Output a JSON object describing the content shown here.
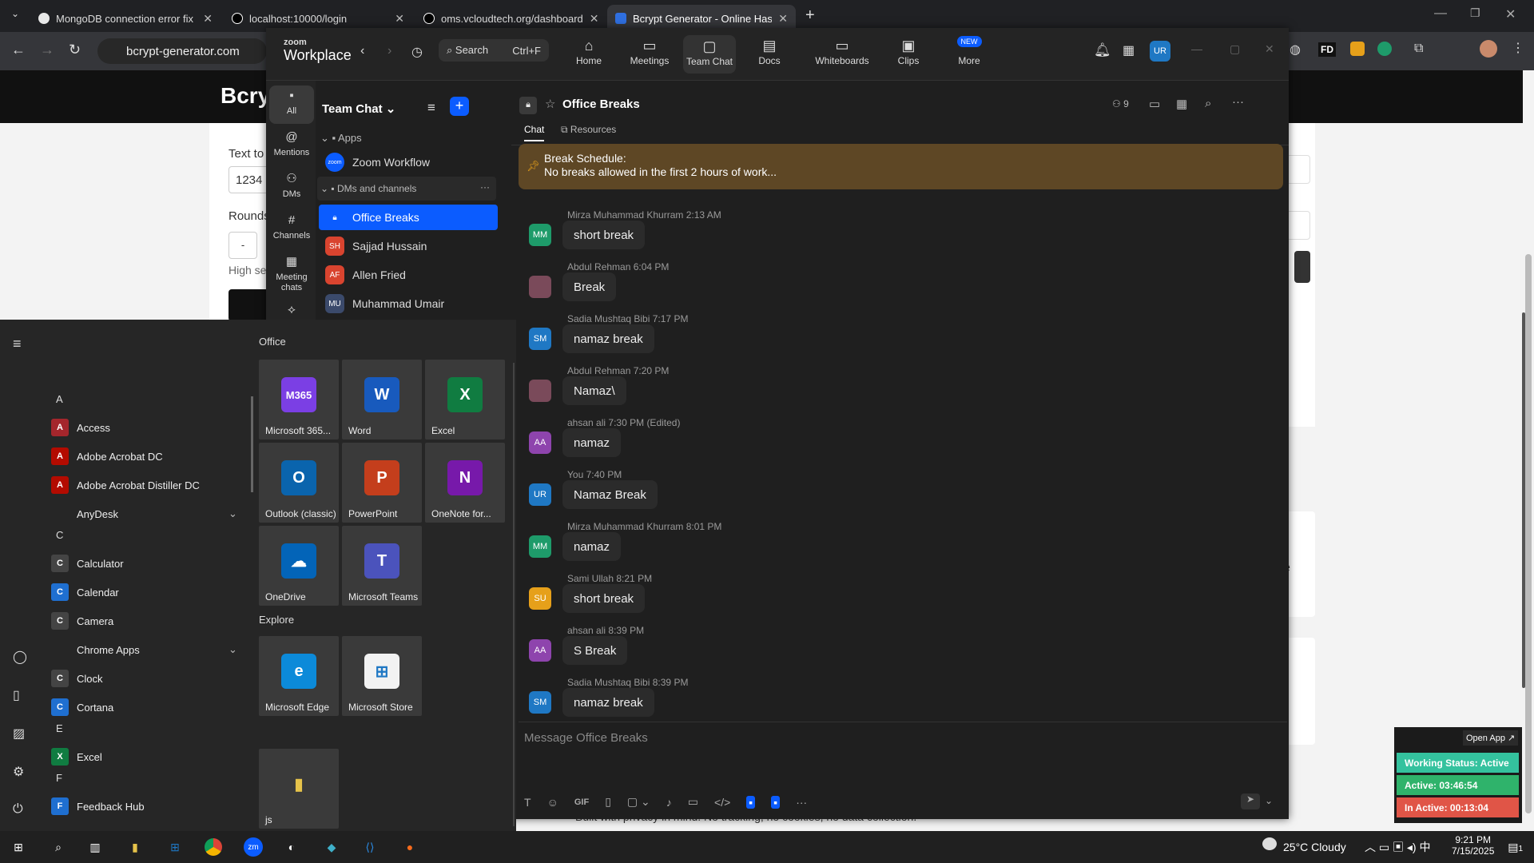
{
  "browser": {
    "tabs": [
      {
        "label": "MongoDB connection error fix",
        "active": false
      },
      {
        "label": "localhost:10000/login",
        "active": false
      },
      {
        "label": "oms.vcloudtech.org/dashboard",
        "active": false
      },
      {
        "label": "Bcrypt Generator - Online Hash",
        "active": true
      }
    ],
    "url": "bcrypt-generator.com"
  },
  "behind_page": {
    "title": "Bcry",
    "text_to_label": "Text to",
    "input_value": "1234",
    "rounds_label": "Rounds",
    "minus": "-",
    "high_label": "High se",
    "footer_text": "Built with privacy in mind. No tracking, no cookies, no data collection.",
    "side_letter": "e"
  },
  "zoom": {
    "brand_top": "zoom",
    "brand": "Workplace",
    "search_label": "Search",
    "search_shortcut": "Ctrl+F",
    "nav": [
      {
        "label": "Home",
        "icon": "home-icon"
      },
      {
        "label": "Meetings",
        "icon": "video-icon"
      },
      {
        "label": "Team Chat",
        "icon": "chat-icon"
      },
      {
        "label": "Docs",
        "icon": "doc-icon"
      },
      {
        "label": "Whiteboards",
        "icon": "whiteboard-icon"
      },
      {
        "label": "Clips",
        "icon": "clips-icon"
      },
      {
        "label": "More",
        "icon": "more-icon",
        "badge": "NEW"
      }
    ],
    "avatar": "UR",
    "rail": [
      "All",
      "Mentions",
      "DMs",
      "Channels",
      "Meeting chats"
    ],
    "list_title": "Team Chat",
    "apps_section": "Apps",
    "app_item": "Zoom Workflow",
    "app_badge": "zoom",
    "dm_section": "DMs and channels",
    "dm_items": [
      {
        "label": "Office Breaks",
        "initials": "",
        "color": "#0b5cff"
      },
      {
        "label": "Sajjad Hussain",
        "initials": "SH",
        "color": "#d9442f"
      },
      {
        "label": "Allen Fried",
        "initials": "AF",
        "color": "#d9442f"
      },
      {
        "label": "Muhammad Umair",
        "initials": "MU",
        "color": "#3b4a6b"
      }
    ],
    "channel_title": "Office Breaks",
    "member_count": "9",
    "tabs": [
      "Chat",
      "Resources"
    ],
    "pinned_title": "Break Schedule:",
    "pinned_text": "No breaks allowed in the first 2 hours of work...",
    "messages": [
      {
        "author": "Mirza Muhammad Khurram",
        "time": "2:13 AM",
        "initials": "MM",
        "color": "#1e9b6a",
        "text": "short break",
        "edited": ""
      },
      {
        "author": "Abdul Rehman",
        "time": "6:04 PM",
        "initials": "",
        "color": "#7a4a5a",
        "text": "Break",
        "edited": ""
      },
      {
        "author": "Sadia Mushtaq Bibi",
        "time": "7:17 PM",
        "initials": "SM",
        "color": "#1f78c4",
        "text": "namaz break",
        "edited": ""
      },
      {
        "author": "Abdul Rehman",
        "time": "7:20 PM",
        "initials": "",
        "color": "#7a4a5a",
        "text": "Namaz\\",
        "edited": ""
      },
      {
        "author": "ahsan ali",
        "time": "7:30 PM",
        "initials": "AA",
        "color": "#8e44ad",
        "text": "namaz",
        "edited": "(Edited)"
      },
      {
        "author": "You",
        "time": "7:40 PM",
        "initials": "UR",
        "color": "#1f78c4",
        "text": "Namaz Break",
        "edited": ""
      },
      {
        "author": "Mirza Muhammad Khurram",
        "time": "8:01 PM",
        "initials": "MM",
        "color": "#1e9b6a",
        "text": "namaz",
        "edited": ""
      },
      {
        "author": "Sami Ullah",
        "time": "8:21 PM",
        "initials": "SU",
        "color": "#e6a01a",
        "text": "short break",
        "edited": ""
      },
      {
        "author": "ahsan ali",
        "time": "8:39 PM",
        "initials": "AA",
        "color": "#8e44ad",
        "text": "S Break",
        "edited": ""
      },
      {
        "author": "Sadia Mushtaq Bibi",
        "time": "8:39 PM",
        "initials": "SM",
        "color": "#1f78c4",
        "text": "namaz break",
        "edited": ""
      }
    ],
    "compose_placeholder": "Message Office Breaks",
    "gif_label": "GIF"
  },
  "start_menu": {
    "office_label": "Office",
    "explore_label": "Explore",
    "letters": [
      "A",
      "C",
      "E",
      "F"
    ],
    "apps": [
      {
        "label": "Access",
        "icon": "A",
        "color": "#a4262c"
      },
      {
        "label": "Adobe Acrobat DC",
        "icon": "A",
        "color": "#b30b00"
      },
      {
        "label": "Adobe Acrobat Distiller DC",
        "icon": "A",
        "color": "#b30b00"
      },
      {
        "label": "AnyDesk",
        "icon": "",
        "color": ""
      },
      {
        "label": "Calculator",
        "icon": "C",
        "color": "#444"
      },
      {
        "label": "Calendar",
        "icon": "C",
        "color": "#1f6fd0"
      },
      {
        "label": "Camera",
        "icon": "C",
        "color": "#444"
      },
      {
        "label": "Chrome Apps",
        "icon": "",
        "color": ""
      },
      {
        "label": "Clock",
        "icon": "C",
        "color": "#444"
      },
      {
        "label": "Cortana",
        "icon": "C",
        "color": "#1f6fd0"
      },
      {
        "label": "Excel",
        "icon": "X",
        "color": "#107c41"
      },
      {
        "label": "Feedback Hub",
        "icon": "F",
        "color": "#1f6fd0"
      }
    ],
    "tiles": [
      {
        "label": "Microsoft 365...",
        "icon": "M365",
        "color": "#7b3fe4"
      },
      {
        "label": "Word",
        "icon": "W",
        "color": "#185abd"
      },
      {
        "label": "Excel",
        "icon": "X",
        "color": "#107c41"
      },
      {
        "label": "Outlook (classic)",
        "icon": "O",
        "color": "#0a64ad"
      },
      {
        "label": "PowerPoint",
        "icon": "P",
        "color": "#c43e1c"
      },
      {
        "label": "OneNote for...",
        "icon": "N",
        "color": "#7719aa"
      },
      {
        "label": "OneDrive",
        "icon": "☁",
        "color": "#0364b8"
      },
      {
        "label": "Microsoft Teams",
        "icon": "T",
        "color": "#4b53bc"
      }
    ],
    "explore_tiles": [
      {
        "label": "Microsoft Edge",
        "icon": "e",
        "color": "#0c8ad9"
      },
      {
        "label": "Microsoft Store",
        "icon": "⊞",
        "color": "#f2f2f2"
      }
    ],
    "folder_tile": "js"
  },
  "widget": {
    "open_app": "Open App ↗",
    "working_status": "Working Status: Active",
    "active": "Active: 03:46:54",
    "inactive": "In Active: 00:13:04"
  },
  "taskbar": {
    "weather": "25°C  Cloudy",
    "time": "9:21 PM",
    "date": "7/15/2025",
    "notif_count": "1"
  }
}
